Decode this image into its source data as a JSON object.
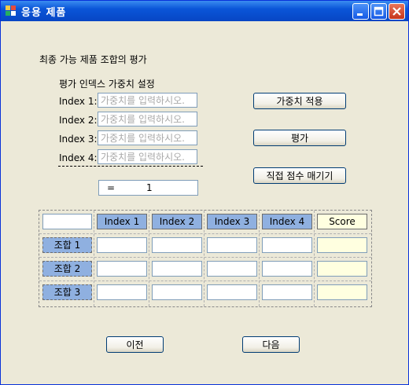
{
  "window": {
    "title": "응용 제품"
  },
  "section_title": "최종 가능 제품 조합의 평가",
  "weights": {
    "heading": "평가 인덱스 가중치 설정",
    "rows": [
      {
        "label": "Index 1:",
        "placeholder": "가중치를 입력하시오."
      },
      {
        "label": "Index 2:",
        "placeholder": "가중치를 입력하시오."
      },
      {
        "label": "Index 3:",
        "placeholder": "가중치를 입력하시오."
      },
      {
        "label": "Index 4:",
        "placeholder": "가중치를 입력하시오."
      }
    ],
    "sum_eq": "=",
    "sum_value": "1"
  },
  "buttons": {
    "apply": "가중치 적용",
    "evaluate": "평가",
    "direct_score": "직접 점수 매기기",
    "prev": "이전",
    "next": "다음"
  },
  "table": {
    "columns": [
      "Index 1",
      "Index 2",
      "Index 3",
      "Index 4",
      "Score"
    ],
    "rows": [
      "조합 1",
      "조합 2",
      "조합 3"
    ]
  }
}
